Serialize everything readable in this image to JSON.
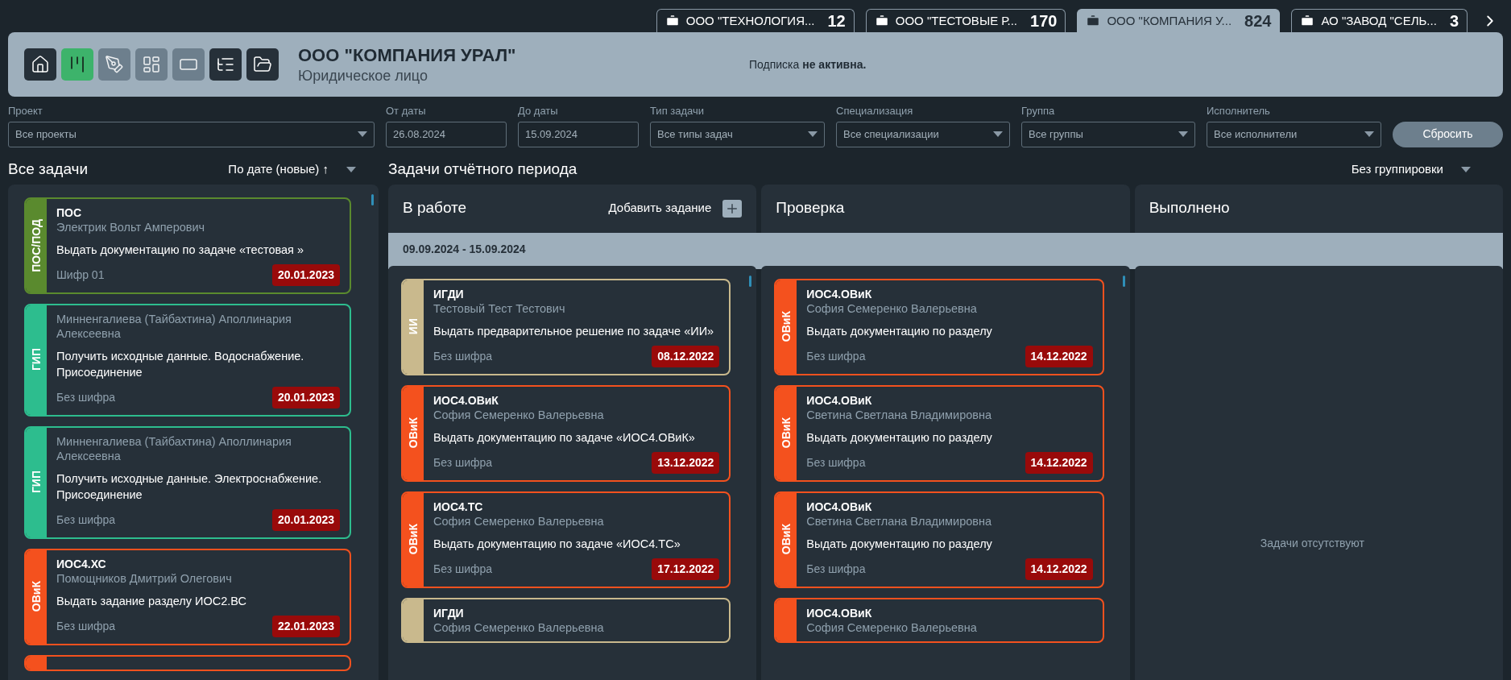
{
  "company_tabs": [
    {
      "name": "ООО \"ТЕХНОЛОГИЯ...",
      "count": "12",
      "selected": false
    },
    {
      "name": "ООО \"ТЕСТОВЫЕ Р...",
      "count": "170",
      "selected": false
    },
    {
      "name": "ООО \"КОМПАНИЯ У...",
      "count": "824",
      "selected": true
    },
    {
      "name": "АО \"ЗАВОД \"СЕЛЬ...",
      "count": "3",
      "selected": false
    }
  ],
  "header": {
    "nav": [
      {
        "selected": false,
        "disabled": false
      },
      {
        "selected": true,
        "disabled": false
      },
      {
        "selected": false,
        "disabled": true
      },
      {
        "selected": false,
        "disabled": true
      },
      {
        "selected": false,
        "disabled": true
      },
      {
        "selected": false,
        "disabled": false
      },
      {
        "selected": false,
        "disabled": false
      }
    ],
    "company": "ООО \"КОМПАНИЯ УРАЛ\"",
    "company_type": "Юридическое лицо",
    "subscription": "Подписка **не активна.**"
  },
  "filters": [
    {
      "label": "Проект",
      "value": "Все проекты",
      "kind": "select"
    },
    {
      "label": "От даты",
      "value": "26.08.2024",
      "kind": "date"
    },
    {
      "label": "До даты",
      "value": "15.09.2024",
      "kind": "date"
    },
    {
      "label": "Тип задачи",
      "value": "Все типы задач",
      "kind": "select"
    },
    {
      "label": "Специализация",
      "value": "Все специализации",
      "kind": "select"
    },
    {
      "label": "Группа",
      "value": "Все группы",
      "kind": "select"
    },
    {
      "label": "Исполнитель",
      "value": "Все исполнители",
      "kind": "select"
    }
  ],
  "reset_button": "Сбросить",
  "all_tasks": {
    "title": "Все задачи",
    "sort": "По дате (новые) ↑",
    "cards": [
      {
        "label": "ПОС/ПОД",
        "color": "#5a8a2e",
        "code": "ПОС",
        "person": "Электрик Вольт Амперович",
        "task": "Выдать документацию по задаче «тестовая »",
        "cipher": "Шифр 01",
        "date": "20.01.2023"
      },
      {
        "label": "ГИП",
        "color": "#2dbd8e",
        "person": "Минненгалиева (Тайбахтина) Аполлинария Алексеевна",
        "task": "Получить исходные данные. Водоснабжение. Присоединение",
        "cipher": "Без шифра",
        "date": "20.01.2023"
      },
      {
        "label": "ГИП",
        "color": "#2dbd8e",
        "person": "Минненгалиева (Тайбахтина) Аполлинария Алексеевна",
        "task": "Получить исходные данные. Электроснабжение. Присоединение",
        "cipher": "Без шифра",
        "date": "20.01.2023"
      },
      {
        "label": "ОВиК",
        "color": "#f4511e",
        "code": "ИОС4.ХС",
        "person": "Помощников Дмитрий Олегович",
        "task": "Выдать задание разделу ИОС2.ВС",
        "cipher": "Без шифра",
        "date": "22.01.2023"
      },
      {
        "color": "#f4511e"
      }
    ]
  },
  "period": {
    "title": "Задачи отчётного периода",
    "grouping": "Без группировки",
    "date_range": "09.09.2024 - 15.09.2024",
    "columns": [
      {
        "title": "В работе",
        "add_task": "Добавить задание",
        "cards": [
          {
            "label": "ИИ",
            "color": "#c9b98d",
            "code": "ИГДИ",
            "person": "Тестовый Тест Тестович",
            "task": "Выдать предварительное решение по задаче «ИИ»",
            "cipher": "Без шифра",
            "date": "08.12.2022"
          },
          {
            "label": "ОВиК",
            "color": "#f4511e",
            "code": "ИОС4.ОВиК",
            "person": "София Семеренко Валерьевна",
            "task": "Выдать документацию по задаче «ИОС4.ОВиК»",
            "cipher": "Без шифра",
            "date": "13.12.2022"
          },
          {
            "label": "ОВиК",
            "color": "#f4511e",
            "code": "ИОС4.ТС",
            "person": "София Семеренко Валерьевна",
            "task": "Выдать документацию по задаче «ИОС4.ТС»",
            "cipher": "Без шифра",
            "date": "17.12.2022"
          },
          {
            "color": "#c9b98d",
            "code": "ИГДИ",
            "person": "София Семеренко Валерьевна"
          }
        ]
      },
      {
        "title": "Проверка",
        "cards": [
          {
            "label": "ОВиК",
            "color": "#f4511e",
            "code": "ИОС4.ОВиК",
            "person": "София Семеренко Валерьевна",
            "task": "Выдать документацию по разделу",
            "cipher": "Без шифра",
            "date": "14.12.2022"
          },
          {
            "label": "ОВиК",
            "color": "#f4511e",
            "code": "ИОС4.ОВиК",
            "person": "Светина Светлана Владимировна",
            "task": "Выдать документацию по разделу",
            "cipher": "Без шифра",
            "date": "14.12.2022"
          },
          {
            "label": "ОВиК",
            "color": "#f4511e",
            "code": "ИОС4.ОВиК",
            "person": "Светина Светлана Владимировна",
            "task": "Выдать документацию по разделу",
            "cipher": "Без шифра",
            "date": "14.12.2022"
          },
          {
            "color": "#f4511e",
            "code": "ИОС4.ОВиК",
            "person": "София Семеренко Валерьевна"
          }
        ]
      },
      {
        "title": "Выполнено",
        "empty_text": "Задачи отсутствуют"
      }
    ]
  }
}
